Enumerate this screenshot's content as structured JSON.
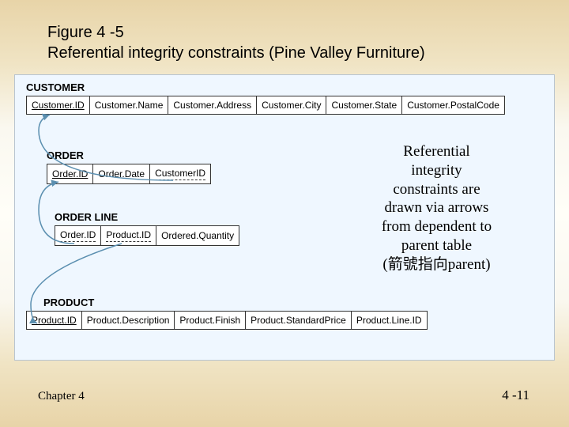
{
  "title_line1": "Figure 4 -5",
  "title_line2": "Referential integrity constraints (Pine Valley Furniture)",
  "tables": {
    "customer": {
      "label": "CUSTOMER",
      "cols": [
        "Customer.ID",
        "Customer.Name",
        "Customer.Address",
        "Customer.City",
        "Customer.State",
        "Customer.PostalCode"
      ]
    },
    "order": {
      "label": "ORDER",
      "cols": [
        "Order.ID",
        "Order.Date",
        "CustomerID"
      ]
    },
    "orderline": {
      "label": "ORDER LINE",
      "cols": [
        "Order.ID",
        "Product.ID",
        "Ordered.Quantity"
      ]
    },
    "product": {
      "label": "PRODUCT",
      "cols": [
        "Product.ID",
        "Product.Description",
        "Product.Finish",
        "Product.StandardPrice",
        "Product.Line.ID"
      ]
    }
  },
  "callout_lines": [
    "Referential",
    "integrity",
    "constraints are",
    "drawn via arrows",
    "from dependent to",
    "parent table",
    "(箭號指向parent)"
  ],
  "footer_left": "Chapter 4",
  "footer_right": "4 -11"
}
